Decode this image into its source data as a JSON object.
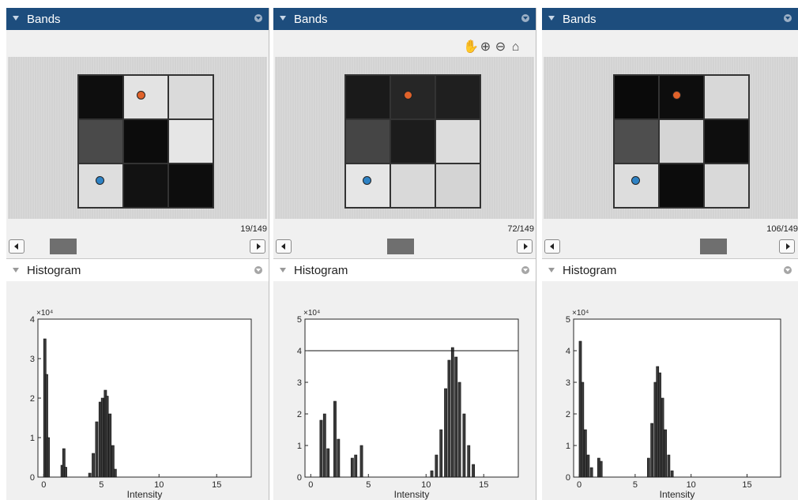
{
  "panels": [
    {
      "bands_title": "Bands",
      "counter": "19/149",
      "histogram_title": "Histogram",
      "toolbar_visible": false,
      "cells": [
        "#0e0e0e",
        "#e3e3e3",
        "#dadada",
        "#4a4a4a",
        "#0c0c0c",
        "#e6e6e6",
        "#dedede",
        "#121212",
        "#0d0d0d"
      ],
      "chart_data": {
        "type": "bar",
        "title": "",
        "xlabel": "Intensity",
        "exponent_label": "×10⁴",
        "xlim": [
          -0.5,
          18
        ],
        "ylim": [
          0,
          4
        ],
        "x_ticks": [
          0,
          5,
          10,
          15
        ],
        "y_ticks": [
          0,
          1,
          2,
          3,
          4
        ],
        "reference_line": null,
        "bars": [
          [
            0.1,
            3.5
          ],
          [
            0.25,
            2.6
          ],
          [
            0.4,
            1.0
          ],
          [
            1.6,
            0.3
          ],
          [
            1.75,
            0.72
          ],
          [
            1.9,
            0.25
          ],
          [
            4.0,
            0.1
          ],
          [
            4.3,
            0.6
          ],
          [
            4.6,
            1.4
          ],
          [
            4.9,
            1.9
          ],
          [
            5.1,
            2.0
          ],
          [
            5.35,
            2.2
          ],
          [
            5.5,
            2.05
          ],
          [
            5.75,
            1.6
          ],
          [
            6.0,
            0.8
          ],
          [
            6.2,
            0.2
          ]
        ]
      }
    },
    {
      "bands_title": "Bands",
      "counter": "72/149",
      "histogram_title": "Histogram",
      "toolbar_visible": true,
      "toolbar_icons": [
        "pan-hand-icon",
        "zoom-in-icon",
        "zoom-out-icon",
        "home-icon"
      ],
      "cells": [
        "#1a1a1a",
        "#262626",
        "#1f1f1f",
        "#454545",
        "#1c1c1c",
        "#dcdcdc",
        "#e6e6e6",
        "#d9d9d9",
        "#d4d4d4"
      ],
      "chart_data": {
        "type": "bar",
        "title": "",
        "xlabel": "Intensity",
        "exponent_label": "×10⁴",
        "xlim": [
          -0.5,
          18
        ],
        "ylim": [
          0,
          5
        ],
        "x_ticks": [
          0,
          5,
          10,
          15
        ],
        "y_ticks": [
          0,
          1,
          2,
          3,
          4,
          5
        ],
        "reference_line": 4,
        "bars": [
          [
            0.9,
            1.8
          ],
          [
            1.2,
            2.0
          ],
          [
            1.5,
            0.9
          ],
          [
            2.1,
            2.4
          ],
          [
            2.4,
            1.2
          ],
          [
            3.6,
            0.6
          ],
          [
            3.9,
            0.7
          ],
          [
            4.4,
            1.0
          ],
          [
            10.5,
            0.2
          ],
          [
            10.9,
            0.7
          ],
          [
            11.3,
            1.5
          ],
          [
            11.7,
            2.8
          ],
          [
            12.0,
            3.7
          ],
          [
            12.3,
            4.1
          ],
          [
            12.6,
            3.8
          ],
          [
            12.9,
            3.0
          ],
          [
            13.3,
            2.0
          ],
          [
            13.7,
            1.0
          ],
          [
            14.1,
            0.4
          ]
        ]
      }
    },
    {
      "bands_title": "Bands",
      "counter": "106/149",
      "histogram_title": "Histogram",
      "toolbar_visible": false,
      "cells": [
        "#0a0a0a",
        "#0d0d0d",
        "#d8d8d8",
        "#4e4e4e",
        "#d5d5d5",
        "#0e0e0e",
        "#dddddd",
        "#0c0c0c",
        "#d9d9d9"
      ],
      "chart_data": {
        "type": "bar",
        "title": "",
        "xlabel": "Intensity",
        "exponent_label": "×10⁴",
        "xlim": [
          -0.5,
          18
        ],
        "ylim": [
          0,
          5
        ],
        "x_ticks": [
          0,
          5,
          10,
          15
        ],
        "y_ticks": [
          0,
          1,
          2,
          3,
          4,
          5
        ],
        "reference_line": null,
        "bars": [
          [
            0.1,
            4.3
          ],
          [
            0.3,
            3.0
          ],
          [
            0.55,
            1.5
          ],
          [
            0.8,
            0.7
          ],
          [
            1.1,
            0.3
          ],
          [
            1.75,
            0.6
          ],
          [
            1.95,
            0.5
          ],
          [
            6.2,
            0.6
          ],
          [
            6.5,
            1.7
          ],
          [
            6.8,
            3.0
          ],
          [
            7.0,
            3.5
          ],
          [
            7.2,
            3.3
          ],
          [
            7.45,
            2.5
          ],
          [
            7.7,
            1.5
          ],
          [
            8.0,
            0.7
          ],
          [
            8.3,
            0.2
          ]
        ]
      }
    }
  ]
}
